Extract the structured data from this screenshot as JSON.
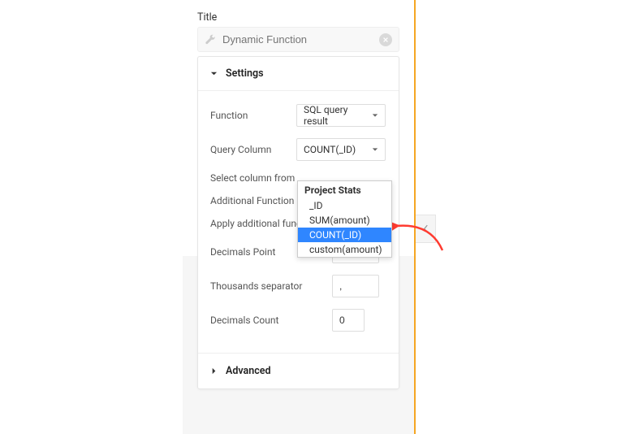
{
  "titleSection": {
    "label": "Title",
    "placeholder": "Dynamic Function"
  },
  "panel": {
    "settings": {
      "header": "Settings",
      "function": {
        "label": "Function",
        "value": "SQL query result"
      },
      "queryColumn": {
        "label": "Query Column",
        "value": "COUNT(_ID)"
      },
      "selectColumnHint": "Select column from",
      "additionalFunction": {
        "label": "Additional Function"
      },
      "additionalHint": "Apply additional function to SQL query",
      "decimalsPoint": {
        "label": "Decimals Point",
        "value": "."
      },
      "thousandsSeparator": {
        "label": "Thousands separator",
        "value": ","
      },
      "decimalsCount": {
        "label": "Decimals Count",
        "value": "0"
      }
    },
    "advanced": {
      "header": "Advanced"
    }
  },
  "dropdown": {
    "groupLabel": "Project Stats",
    "options": [
      "_ID",
      "SUM(amount)",
      "COUNT(_ID)",
      "custom(amount)"
    ],
    "selected": "COUNT(_ID)"
  }
}
